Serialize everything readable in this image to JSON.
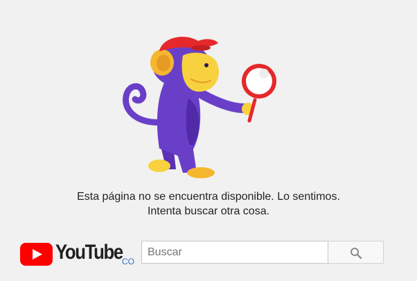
{
  "error": {
    "line1": "Esta página no se encuentra disponible. Lo sentimos.",
    "line2": "Intenta buscar otra cosa.",
    "illustration": "monkey-with-magnifying-glass"
  },
  "brand": {
    "wordmark": "YouTube",
    "country_code": "CO",
    "logo": "youtube-logo-icon"
  },
  "search": {
    "placeholder": "Buscar",
    "value": "",
    "button_icon": "search-icon"
  },
  "colors": {
    "background": "#f1f1f1",
    "youtube_red": "#ff0000",
    "monkey_purple": "#6a3fc8",
    "monkey_face": "#f7d23e",
    "cap_red": "#e5282b"
  }
}
